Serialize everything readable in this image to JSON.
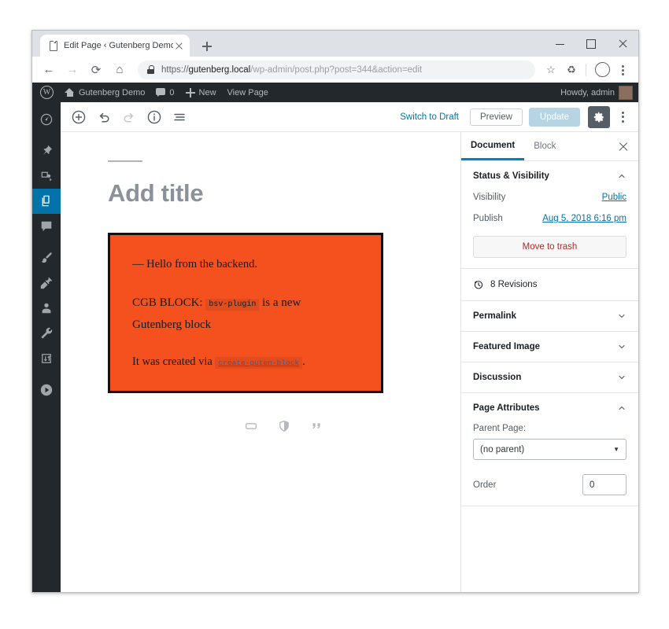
{
  "browser": {
    "tab": {
      "title": "Edit Page ‹ Gutenberg Demo — …",
      "favicon": "page-icon"
    },
    "new_tab_label": "+",
    "window_controls": {
      "minimize": "minimize-icon",
      "maximize": "maximize-icon",
      "close": "close-icon"
    },
    "nav": {
      "back": "←",
      "forward": "→",
      "reload": "⟳",
      "home": "⌂"
    },
    "omnibox": {
      "lock": "lock-icon",
      "scheme": "https://",
      "host": "gutenberg.local",
      "path": "/wp-admin/post.php?post=344&action=edit",
      "full_url": "https://gutenberg.local/wp-admin/post.php?post=344&action=edit"
    },
    "toolbar_icons": {
      "bookmark": "star-icon",
      "extension": "recycle-icon",
      "profile": "avatar-icon",
      "menu": "kebab-menu-icon"
    }
  },
  "adminbar": {
    "logo": "wordpress-logo",
    "site_name": "Gutenberg Demo",
    "comment_count": "0",
    "new_label": "New",
    "view_page_label": "View Page",
    "howdy": "Howdy, admin"
  },
  "adminmenu": {
    "items": [
      {
        "name": "dashboard",
        "icon": "dashboard-icon",
        "active": false
      },
      {
        "name": "posts",
        "icon": "pin-icon",
        "active": false
      },
      {
        "name": "media",
        "icon": "media-icon",
        "active": false
      },
      {
        "name": "pages",
        "icon": "pages-icon",
        "active": true
      },
      {
        "name": "comments",
        "icon": "comment-icon",
        "active": false
      },
      {
        "name": "appearance",
        "icon": "brush-icon",
        "active": false
      },
      {
        "name": "plugins",
        "icon": "plug-icon",
        "active": false
      },
      {
        "name": "users",
        "icon": "user-icon",
        "active": false
      },
      {
        "name": "tools",
        "icon": "wrench-icon",
        "active": false
      },
      {
        "name": "settings",
        "icon": "settings-icon",
        "active": false
      },
      {
        "name": "collapse",
        "icon": "circle-play-icon",
        "active": false
      }
    ]
  },
  "editor_toolbar": {
    "add_block": "add-block-icon",
    "undo": "undo-icon",
    "redo": "redo-icon",
    "info": "info-icon",
    "block_navigation": "block-navigation-icon",
    "switch_to_draft": "Switch to Draft",
    "preview": "Preview",
    "update": "Update",
    "settings_gear": "gear-icon",
    "more_menu": "kebab-menu-icon"
  },
  "canvas": {
    "title_placeholder": "Add title",
    "block": {
      "paragraph_1": "— Hello from the backend.",
      "paragraph_2_pre": "CGB BLOCK: ",
      "paragraph_2_code": "bsv-plugin",
      "paragraph_2_post": " is a new",
      "paragraph_3": "Gutenberg block",
      "paragraph_4_pre": "It was created via ",
      "paragraph_4_link": "create-guten-block",
      "paragraph_4_post": ".",
      "background_color": "#f4511e",
      "border_color": "#111111"
    },
    "inserters": [
      {
        "name": "paragraph-block-icon"
      },
      {
        "name": "shield-block-icon"
      },
      {
        "name": "quote-block-icon"
      }
    ]
  },
  "sidebar": {
    "tabs": [
      {
        "label": "Document",
        "active": true
      },
      {
        "label": "Block",
        "active": false
      }
    ],
    "close_icon": "close-icon",
    "status_panel": {
      "title": "Status & Visibility",
      "expanded": true,
      "visibility_label": "Visibility",
      "visibility_value": "Public",
      "publish_label": "Publish",
      "publish_value": "Aug 5, 2018 6:16 pm",
      "trash_label": "Move to trash"
    },
    "revisions": {
      "icon": "revisions-clock-icon",
      "label": "8 Revisions"
    },
    "collapsed_panels": [
      {
        "label": "Permalink"
      },
      {
        "label": "Featured Image"
      },
      {
        "label": "Discussion"
      }
    ],
    "page_attributes": {
      "title": "Page Attributes",
      "expanded": true,
      "parent_label": "Parent Page:",
      "parent_value": "(no parent)",
      "order_label": "Order",
      "order_value": "0"
    }
  },
  "colors": {
    "wp_admin_dark": "#23282d",
    "wp_blue": "#0073aa",
    "accent_tab": "#0085ba",
    "block_orange": "#f4511e",
    "trash_red": "#b52727"
  }
}
